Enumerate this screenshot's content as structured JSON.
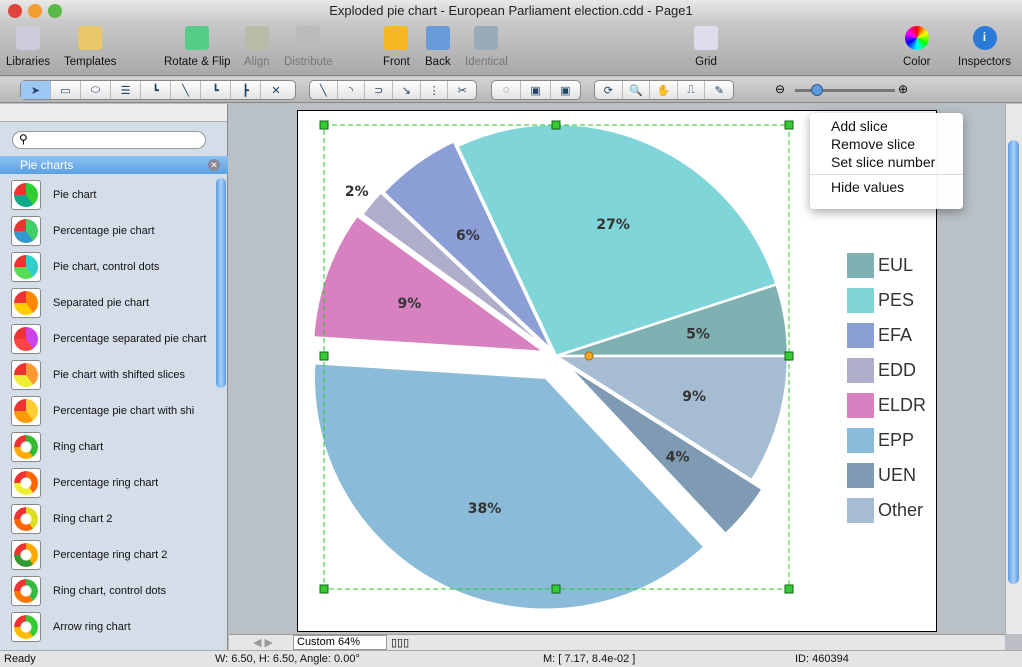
{
  "window": {
    "title": "Exploded pie chart - European Parliament election.cdd - Page1"
  },
  "toolbar": {
    "libraries": "Libraries",
    "templates": "Templates",
    "rotate_flip": "Rotate & Flip",
    "align": "Align",
    "distribute": "Distribute",
    "front": "Front",
    "back": "Back",
    "identical": "Identical",
    "grid": "Grid",
    "color": "Color",
    "inspectors": "Inspectors"
  },
  "sidebar": {
    "section": "Pie charts",
    "items": [
      "Pie chart",
      "Percentage pie chart",
      "Pie chart, control dots",
      "Separated pie chart",
      "Percentage separated pie chart",
      "Pie chart with shifted slices",
      "Percentage pie chart with shi",
      "Ring chart",
      "Percentage ring chart",
      "Ring chart 2",
      "Percentage ring chart 2",
      "Ring chart, control dots",
      "Arrow ring chart"
    ]
  },
  "context_menu": [
    "Add slice",
    "Remove slice",
    "Set slice number",
    "Hide values"
  ],
  "zoom": "Custom 64%",
  "status": {
    "state": "Ready",
    "size": "W: 6.50,  H: 6.50,  Angle: 0.00°",
    "mouse": "M: [ 7.17, 8.4e-02 ]",
    "id": "ID: 460394"
  },
  "chart_data": {
    "type": "pie",
    "exploded": true,
    "slices": [
      {
        "name": "EUL",
        "value": 5,
        "label": "5%",
        "color": "#7fb0b2",
        "explode": 0
      },
      {
        "name": "PES",
        "value": 27,
        "label": "27%",
        "color": "#7fd5d7",
        "explode": 0
      },
      {
        "name": "EFA",
        "value": 6,
        "label": "6%",
        "color": "#8b9fd6",
        "explode": 6
      },
      {
        "name": "EDD",
        "value": 2,
        "label": "2%",
        "color": "#aeaecb",
        "explode": 8
      },
      {
        "name": "ELDR",
        "value": 9,
        "label": "9%",
        "color": "#d781c0",
        "explode": 12
      },
      {
        "name": "EPP",
        "value": 38,
        "label": "38%",
        "color": "#8abbd9",
        "explode": 24
      },
      {
        "name": "UEN",
        "value": 4,
        "label": "4%",
        "color": "#7f9bb3",
        "explode": 14
      },
      {
        "name": "Other",
        "value": 9,
        "label": "9%",
        "color": "#a6bcd2",
        "explode": 0
      }
    ],
    "legend": [
      "EUL",
      "PES",
      "EFA",
      "EDD",
      "ELDR",
      "EPP",
      "UEN",
      "Other"
    ],
    "legend_placement": "right"
  }
}
